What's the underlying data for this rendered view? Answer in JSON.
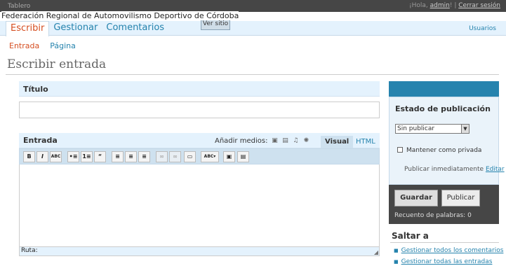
{
  "topbar": {
    "dashboard": "Tablero",
    "greeting": "¡Hola,",
    "username": "admin",
    "greeting_end": "!",
    "separator": "|",
    "logout": "Cerrar sesión"
  },
  "site": {
    "name": "Federación Regional de Automovilismo Deportivo de Córdoba",
    "view_site": "Ver sitio"
  },
  "mainmenu": [
    {
      "label": "Escribir",
      "active": true
    },
    {
      "label": "Gestionar",
      "active": false
    },
    {
      "label": "Comentarios",
      "active": false
    }
  ],
  "users_link": "Usuarios",
  "submenu": [
    {
      "label": "Entrada",
      "active": true
    },
    {
      "label": "Página",
      "active": false
    }
  ],
  "page_title": "Escribir entrada",
  "title_box": {
    "label": "Título",
    "value": ""
  },
  "editor": {
    "label": "Entrada",
    "add_media": "Añadir medios:",
    "media_icons": [
      "image-icon",
      "video-icon",
      "audio-icon",
      "media-icon"
    ],
    "tab_visual": "Visual",
    "tab_html": "HTML",
    "toolbar": [
      {
        "name": "bold-button",
        "glyph": "B"
      },
      {
        "name": "italic-button",
        "glyph": "I"
      },
      {
        "name": "strikethrough-button",
        "glyph": "ABC"
      },
      {
        "name": "bullet-list-button",
        "glyph": "•≡"
      },
      {
        "name": "numbered-list-button",
        "glyph": "1≡"
      },
      {
        "name": "blockquote-button",
        "glyph": "“"
      },
      {
        "name": "align-left-button",
        "glyph": "≡"
      },
      {
        "name": "align-center-button",
        "glyph": "≡"
      },
      {
        "name": "align-right-button",
        "glyph": "≡"
      },
      {
        "name": "insert-link-button",
        "glyph": "∞"
      },
      {
        "name": "unlink-button",
        "glyph": "∞"
      },
      {
        "name": "insert-more-button",
        "glyph": "▭"
      },
      {
        "name": "spellcheck-button",
        "glyph": "ABC▾"
      },
      {
        "name": "fullscreen-button",
        "glyph": "▣"
      },
      {
        "name": "kitchen-sink-button",
        "glyph": "▤"
      }
    ],
    "path_label": "Ruta:"
  },
  "publish": {
    "title": "Estado de publicación",
    "status_value": "Sin publicar",
    "private_label": "Mantener como privada",
    "publish_now": "Publicar inmediatamente",
    "edit_link": "Editar",
    "save_button": "Guardar",
    "publish_button": "Publicar",
    "word_count_label": "Recuento de palabras:",
    "word_count": "0"
  },
  "jump": {
    "title": "Saltar a",
    "links": [
      "Gestionar todos los comentarios",
      "Gestionar todas las entradas"
    ]
  },
  "colors": {
    "accent": "#2583ad",
    "active": "#d54e21",
    "nav_bg": "#e4f2fd",
    "topbar_bg": "#464646"
  }
}
